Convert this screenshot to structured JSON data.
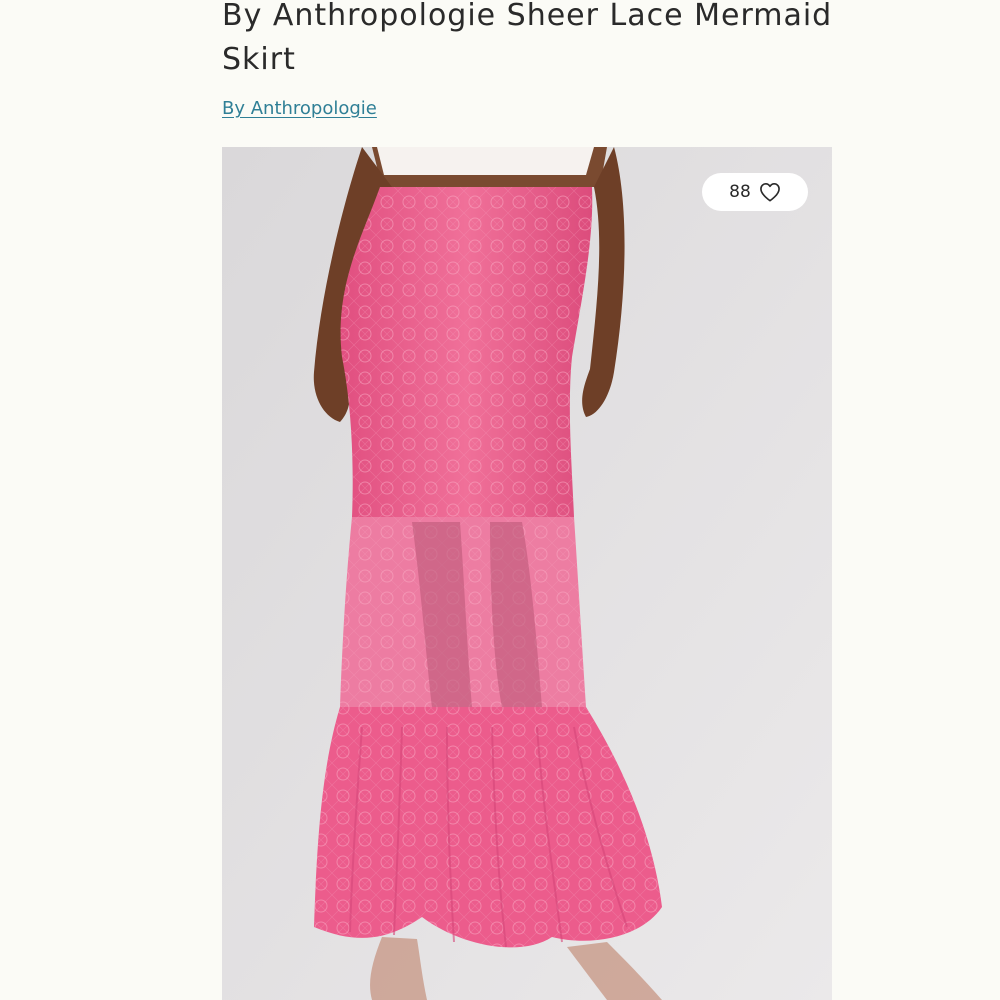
{
  "product": {
    "title": "By Anthropologie Sheer Lace Mermaid Skirt",
    "brand_link": "By Anthropologie",
    "like_count": "88"
  },
  "icons": {
    "like": "heart-outline-icon"
  },
  "colors": {
    "background": "#fbfbf6",
    "title_text": "#2a2a2a",
    "link": "#2f7f96",
    "skirt": "#ec5c8c",
    "like_pill": "#ffffff"
  }
}
